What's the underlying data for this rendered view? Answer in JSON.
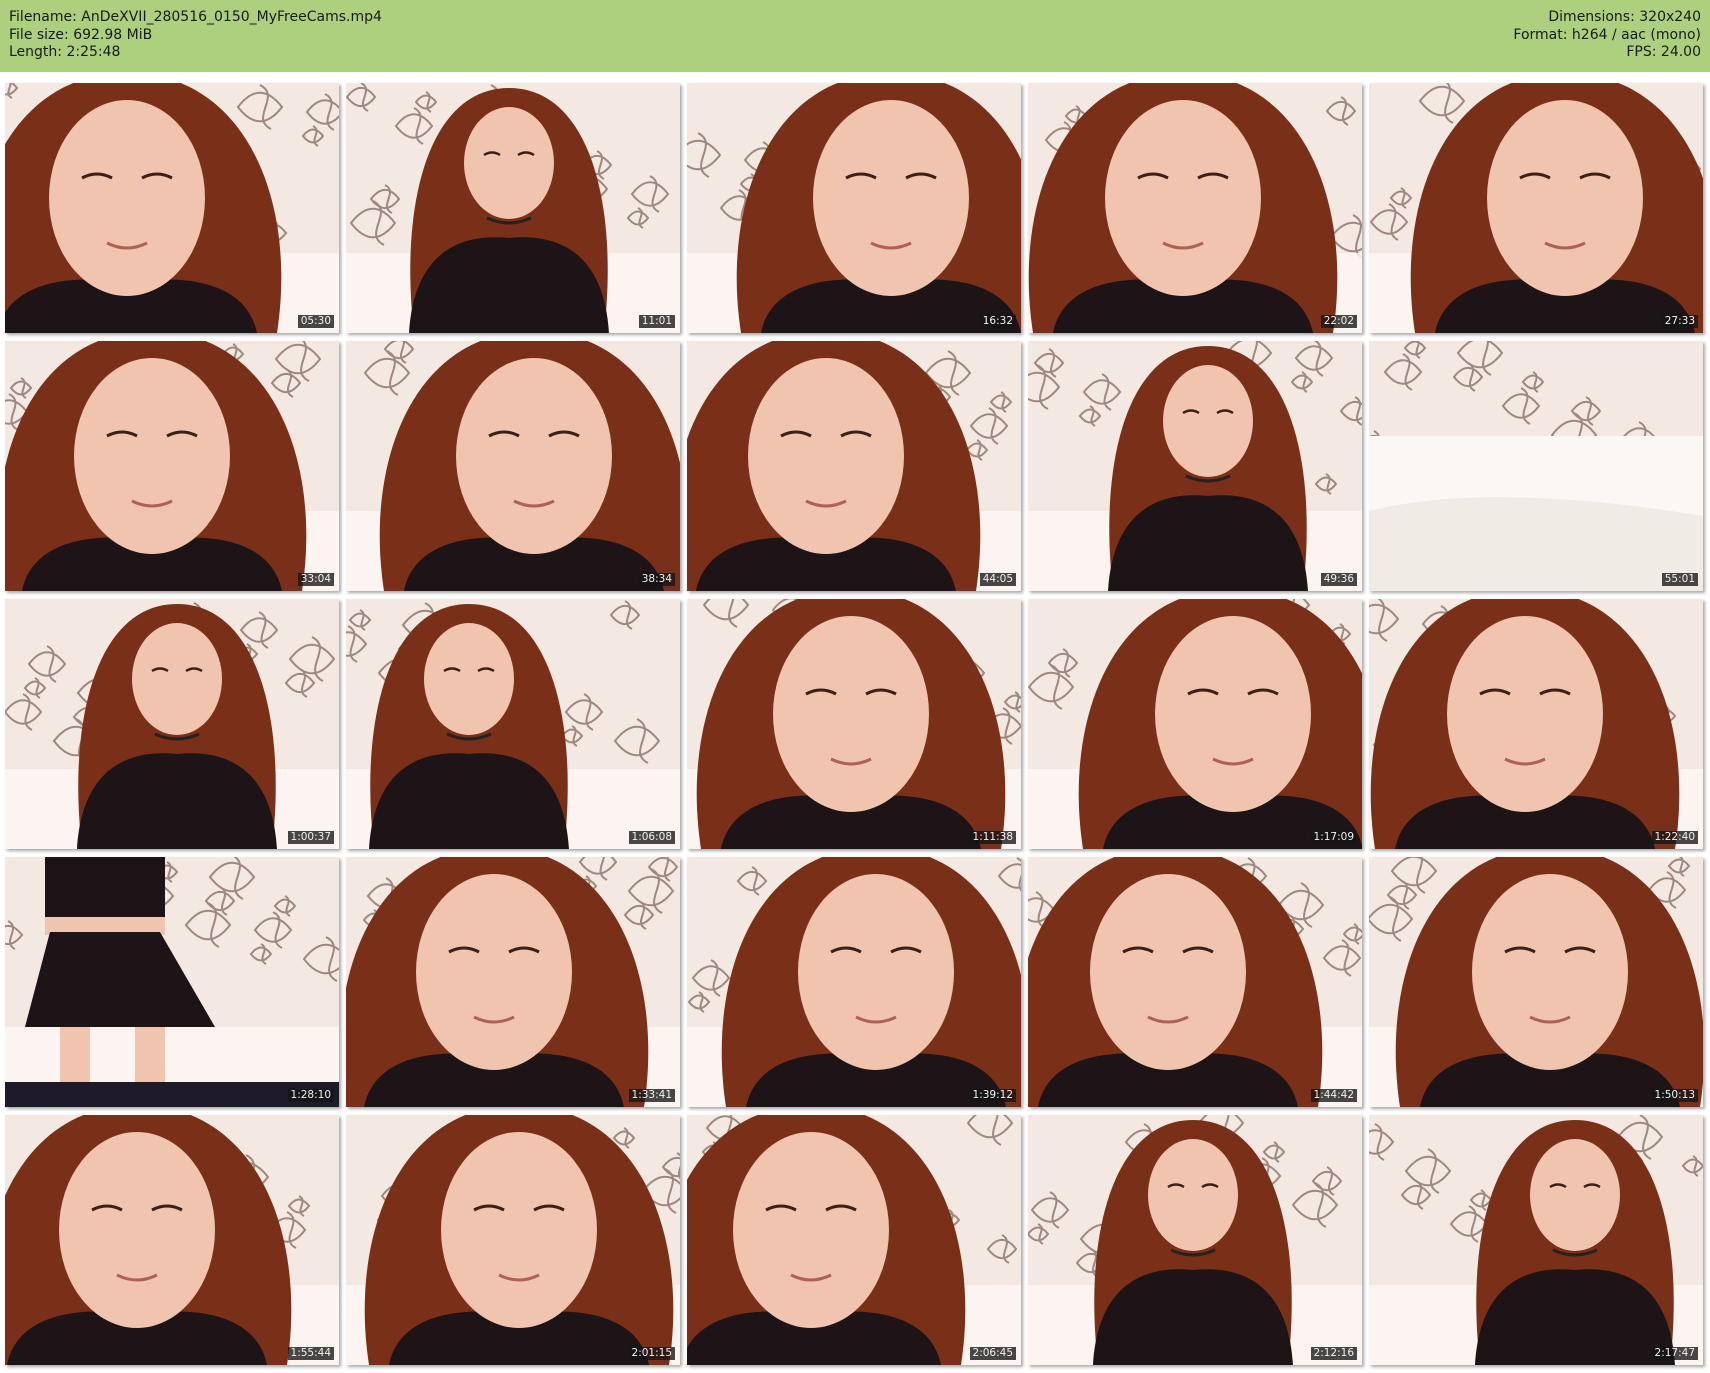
{
  "header": {
    "filename": "Filename: AnDeXVII_280516_0150_MyFreeCams.mp4",
    "filesize": "File size: 692.98 MiB",
    "length": "Length: 2:25:48",
    "dimensions": "Dimensions: 320x240",
    "format": "Format: h264 / aac (mono)",
    "fps": "FPS: 24.00"
  },
  "colors": {
    "header_bg": "#add07e",
    "wall": "#f3e9e2",
    "hair": "#7a3018",
    "skin": "#f0c4ae",
    "clothing": "#1c1416"
  },
  "thumbnails": [
    {
      "time": "05:30",
      "scene": "closeup"
    },
    {
      "time": "11:01",
      "scene": "sitting"
    },
    {
      "time": "16:32",
      "scene": "closeup"
    },
    {
      "time": "22:02",
      "scene": "closeup"
    },
    {
      "time": "27:33",
      "scene": "closeup"
    },
    {
      "time": "33:04",
      "scene": "closeup"
    },
    {
      "time": "38:34",
      "scene": "closeup"
    },
    {
      "time": "44:05",
      "scene": "closeup"
    },
    {
      "time": "49:36",
      "scene": "sitting"
    },
    {
      "time": "55:01",
      "scene": "empty"
    },
    {
      "time": "1:00:37",
      "scene": "sitting"
    },
    {
      "time": "1:06:08",
      "scene": "sitting"
    },
    {
      "time": "1:11:38",
      "scene": "closeup"
    },
    {
      "time": "1:17:09",
      "scene": "closeup"
    },
    {
      "time": "1:22:40",
      "scene": "closeup"
    },
    {
      "time": "1:28:10",
      "scene": "standing"
    },
    {
      "time": "1:33:41",
      "scene": "closeup"
    },
    {
      "time": "1:39:12",
      "scene": "closeup"
    },
    {
      "time": "1:44:42",
      "scene": "closeup"
    },
    {
      "time": "1:50:13",
      "scene": "closeup"
    },
    {
      "time": "1:55:44",
      "scene": "closeup"
    },
    {
      "time": "2:01:15",
      "scene": "closeup"
    },
    {
      "time": "2:06:45",
      "scene": "closeup"
    },
    {
      "time": "2:12:16",
      "scene": "sitting"
    },
    {
      "time": "2:17:47",
      "scene": "sitting"
    }
  ]
}
